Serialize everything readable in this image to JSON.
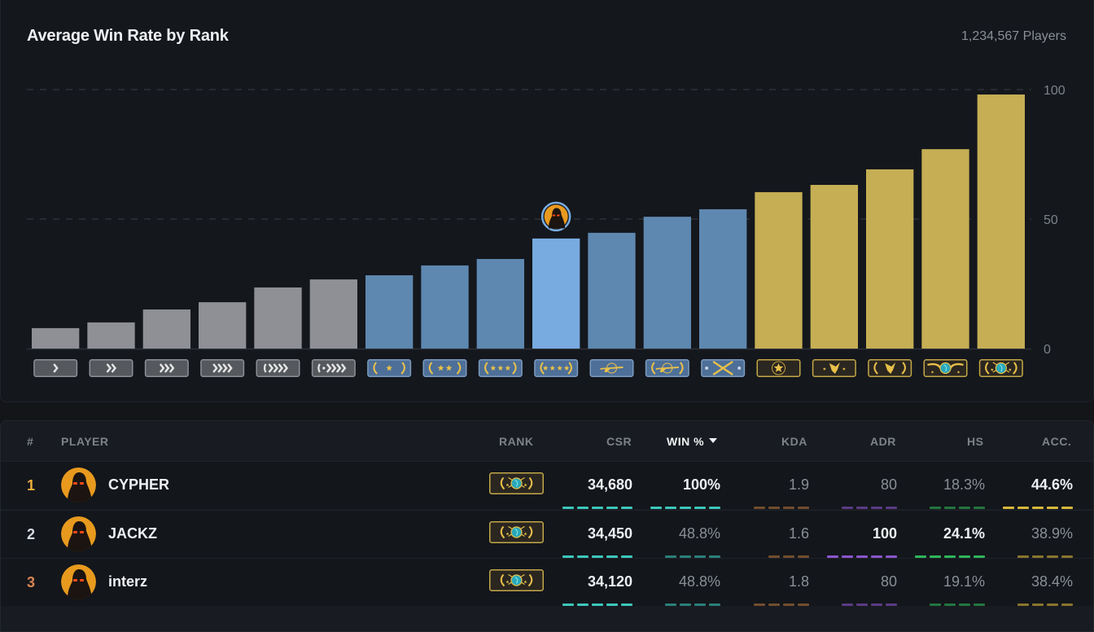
{
  "chart_card": {
    "title": "Average Win Rate by Rank",
    "players_count": "1,234,567 Players"
  },
  "chart_data": {
    "type": "bar",
    "title": "Average Win Rate by Rank",
    "subtitle": "1,234,567 Players",
    "xlabel": "",
    "ylabel": "",
    "ylim": [
      0,
      100
    ],
    "yticks": [
      0,
      50,
      100
    ],
    "ytick_labels": [
      "0",
      "50",
      "100"
    ],
    "grid": "horizontal-dashed",
    "y_axis_side": "right",
    "categories": [
      "Silver I",
      "Silver II",
      "Silver III",
      "Silver IV",
      "Silver Elite",
      "Silver Elite Master",
      "Gold Nova I",
      "Gold Nova II",
      "Gold Nova III",
      "Gold Nova Master",
      "Master Guardian I",
      "Master Guardian II",
      "Master Guardian Elite",
      "Distinguished Master Guardian",
      "Legendary Eagle",
      "Legendary Eagle Master",
      "Supreme Master First Class",
      "Global Elite"
    ],
    "values": [
      7.9,
      10.1,
      15.1,
      17.9,
      23.6,
      26.7,
      28.3,
      32.1,
      34.6,
      42.5,
      44.7,
      50.9,
      53.8,
      60.4,
      63.2,
      69.2,
      77.0,
      98.1
    ],
    "tier": [
      "silver",
      "silver",
      "silver",
      "silver",
      "silver",
      "silver",
      "nova",
      "nova",
      "nova",
      "nova",
      "guardian",
      "guardian",
      "guardian",
      "elite",
      "elite",
      "elite",
      "elite",
      "elite"
    ],
    "highlighted_index": 9,
    "highlight_marker": "player-avatar",
    "colors": {
      "silver": "#8f9095",
      "nova": "#5e88b0",
      "guardian": "#5e88b0",
      "elite": "#c5ae54",
      "highlight": "#78abe0",
      "grid": "#3a3e46",
      "axis_text": "#7d828b"
    },
    "badges": [
      {
        "tier": "silver",
        "icon": "chevron-1"
      },
      {
        "tier": "silver",
        "icon": "chevron-2"
      },
      {
        "tier": "silver",
        "icon": "chevron-3"
      },
      {
        "tier": "silver",
        "icon": "chevron-4"
      },
      {
        "tier": "silver",
        "icon": "chevron-elite"
      },
      {
        "tier": "silver",
        "icon": "chevron-elite-master"
      },
      {
        "tier": "nova",
        "icon": "stars-1"
      },
      {
        "tier": "nova",
        "icon": "stars-2"
      },
      {
        "tier": "nova",
        "icon": "stars-3"
      },
      {
        "tier": "nova",
        "icon": "stars-4"
      },
      {
        "tier": "guardian",
        "icon": "rifle"
      },
      {
        "tier": "guardian",
        "icon": "rifle-wreath"
      },
      {
        "tier": "guardian",
        "icon": "crossed-rifles"
      },
      {
        "tier": "elite",
        "icon": "star-emblem"
      },
      {
        "tier": "elite",
        "icon": "eagle"
      },
      {
        "tier": "elite",
        "icon": "eagle-wreath"
      },
      {
        "tier": "elite",
        "icon": "winged-globe"
      },
      {
        "tier": "elite",
        "icon": "globe-wreath"
      }
    ]
  },
  "table": {
    "headers": {
      "num": "#",
      "player": "PLAYER",
      "rank": "RANK",
      "csr": "CSR",
      "win": "WIN %",
      "kda": "KDA",
      "adr": "ADR",
      "hs": "HS",
      "acc": "ACC."
    },
    "sorted_by": "win",
    "sort_direction": "desc",
    "stat_colors": {
      "csr": "#3cc7bb",
      "win": "#3cc7bb",
      "kda": "#b0733a",
      "adr": "#8a55cc",
      "hs": "#2fb55a",
      "acc": "#d8b83a"
    },
    "rows": [
      {
        "pos": "1",
        "pos_color": "#f0ad3c",
        "name": "CYPHER",
        "rank": "Global Elite",
        "csr": "34,680",
        "win": "100%",
        "kda": "1.9",
        "adr": "80",
        "hs": "18.3%",
        "acc": "44.6%",
        "highlight": [
          "csr",
          "win",
          "acc"
        ],
        "levels": {
          "csr": 5,
          "win": 5,
          "kda": 4,
          "adr": 4,
          "hs": 4,
          "acc": 5
        }
      },
      {
        "pos": "2",
        "pos_color": "#d6dbe2",
        "name": "JACKZ",
        "rank": "Global Elite",
        "csr": "34,450",
        "win": "48.8%",
        "kda": "1.6",
        "adr": "100",
        "hs": "24.1%",
        "acc": "38.9%",
        "highlight": [
          "csr",
          "adr",
          "hs"
        ],
        "levels": {
          "csr": 5,
          "win": 4,
          "kda": 3,
          "adr": 5,
          "hs": 5,
          "acc": 4
        }
      },
      {
        "pos": "3",
        "pos_color": "#d98552",
        "name": "interz",
        "rank": "Global Elite",
        "csr": "34,120",
        "win": "48.8%",
        "kda": "1.8",
        "adr": "80",
        "hs": "19.1%",
        "acc": "38.4%",
        "highlight": [
          "csr"
        ],
        "levels": {
          "csr": 5,
          "win": 4,
          "kda": 4,
          "adr": 4,
          "hs": 4,
          "acc": 4
        }
      }
    ]
  }
}
